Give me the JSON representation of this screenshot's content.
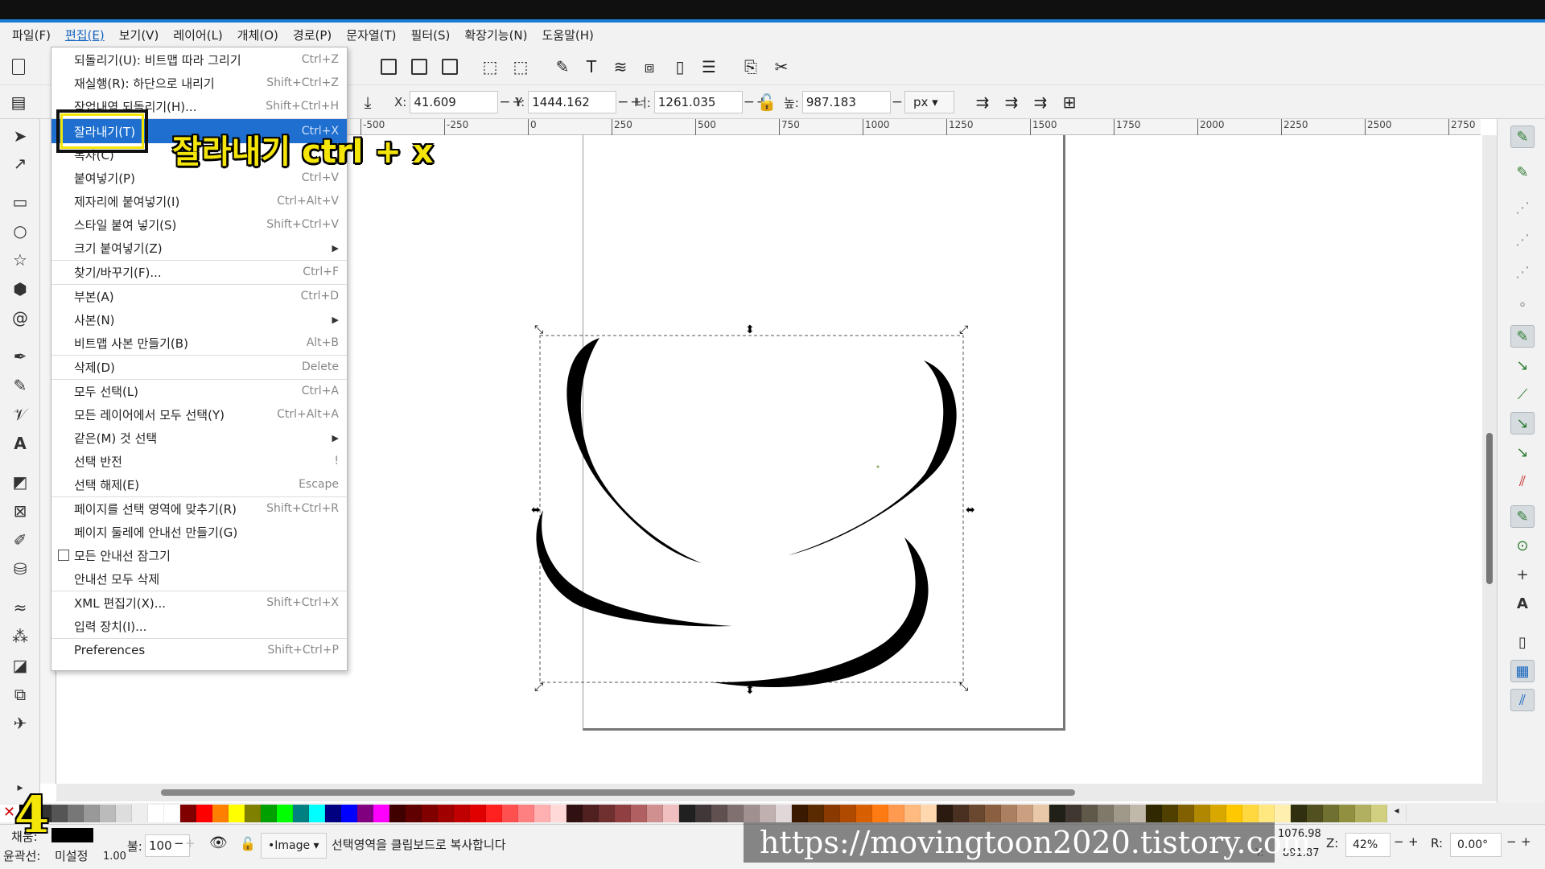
{
  "menubar": {
    "items": [
      "파일(F)",
      "편집(E)",
      "보기(V)",
      "레이어(L)",
      "개체(O)",
      "경로(P)",
      "문자열(T)",
      "필터(S)",
      "확장기능(N)",
      "도움말(H)"
    ]
  },
  "controls": {
    "x_label": "X:",
    "x_value": "41.609",
    "y_label": "Y:",
    "y_value": "1444.162",
    "w_label": "너:",
    "w_value": "1261.035",
    "h_label": "높:",
    "h_value": "987.183",
    "unit": "px",
    "minus": "−",
    "plus": "+"
  },
  "ruler": {
    "ticks": [
      "-500",
      "-250",
      "0",
      "250",
      "500",
      "750",
      "1000",
      "1250",
      "1500",
      "1750",
      "2000",
      "2250",
      "2500",
      "2750"
    ]
  },
  "edit_menu": {
    "items": [
      {
        "label": "되돌리기(U): 비트맵 따라 그리기",
        "shortcut": "Ctrl+Z"
      },
      {
        "label": "재실행(R): 하단으로 내리기",
        "shortcut": "Shift+Ctrl+Z"
      },
      {
        "label": "작업내역 되돌리기(H)...",
        "shortcut": "Shift+Ctrl+H"
      },
      {
        "label": "잘라내기(T)",
        "shortcut": "Ctrl+X"
      },
      {
        "label": "복사(C)",
        "shortcut": ""
      },
      {
        "label": "붙여넣기(P)",
        "shortcut": "Ctrl+V"
      },
      {
        "label": "제자리에 붙여넣기(I)",
        "shortcut": "Ctrl+Alt+V"
      },
      {
        "label": "스타일 붙여 넣기(S)",
        "shortcut": "Shift+Ctrl+V"
      },
      {
        "label": "크기 붙여넣기(Z)",
        "shortcut": ""
      },
      {
        "label": "찾기/바꾸기(F)...",
        "shortcut": "Ctrl+F"
      },
      {
        "label": "부본(A)",
        "shortcut": "Ctrl+D"
      },
      {
        "label": "사본(N)",
        "shortcut": ""
      },
      {
        "label": "비트맵 사본 만들기(B)",
        "shortcut": "Alt+B"
      },
      {
        "label": "삭제(D)",
        "shortcut": "Delete"
      },
      {
        "label": "모두 선택(L)",
        "shortcut": "Ctrl+A"
      },
      {
        "label": "모든 레이어에서 모두 선택(Y)",
        "shortcut": "Ctrl+Alt+A"
      },
      {
        "label": "같은(M) 것 선택",
        "shortcut": ""
      },
      {
        "label": "선택 반전",
        "shortcut": "!"
      },
      {
        "label": "선택 해제(E)",
        "shortcut": "Escape"
      },
      {
        "label": "페이지를 선택 영역에 맞추기(R)",
        "shortcut": "Shift+Ctrl+R"
      },
      {
        "label": "페이지 둘레에 안내선 만들기(G)",
        "shortcut": ""
      },
      {
        "label": "모든 안내선  잠그기",
        "shortcut": ""
      },
      {
        "label": "안내선 모두 삭제",
        "shortcut": ""
      },
      {
        "label": "XML 편집기(X)...",
        "shortcut": "Shift+Ctrl+X"
      },
      {
        "label": "입력 장치(I)...",
        "shortcut": ""
      },
      {
        "label": "Preferences",
        "shortcut": "Shift+Ctrl+P"
      }
    ],
    "submenu_arrow": "▶"
  },
  "annotation": {
    "text": "잘라내기 ctrl + x",
    "step_number": "4"
  },
  "statusbar": {
    "fill_label": "채움:",
    "stroke_label": "윤곽선:",
    "stroke_value": "미설정",
    "stroke_width": "1.00",
    "opacity_label": "불:",
    "opacity_value": "100",
    "layer_value": "•Image",
    "message": "선택영역을 클립보드로 복사합니다",
    "cursor_x": "1076.98",
    "cursor_y_label": "Y:",
    "cursor_y": "891.87",
    "zoom_label": "Z:",
    "zoom_value": "42%",
    "rotate_label": "R:",
    "rotate_value": "0.00°"
  },
  "watermark": "https://movingtoon2020.tistory.com",
  "colors": {
    "accent": "#1e6fd0",
    "annotation": "#f5e60a",
    "snap_green": "#2e7d32"
  }
}
